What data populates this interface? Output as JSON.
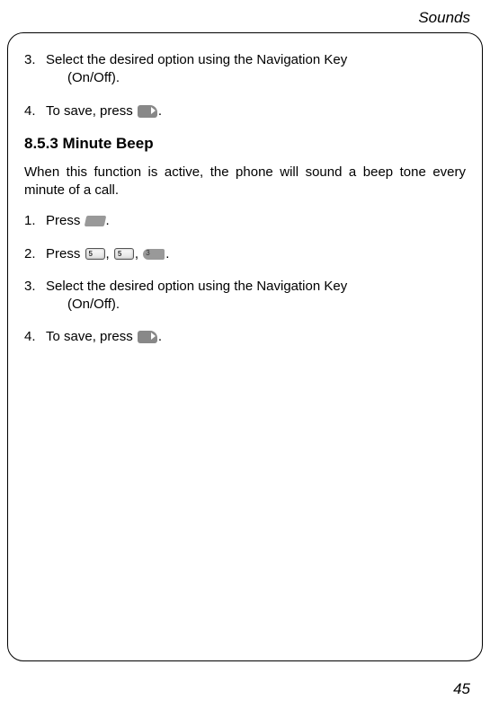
{
  "header": "Sounds",
  "page_number": "45",
  "block1": {
    "step3": {
      "num": "3.",
      "text1": "Select the desired option using the Navigation Key",
      "text2": "(On/Off)."
    },
    "step4": {
      "num": "4.",
      "text_before": "To save, press ",
      "text_after": "."
    }
  },
  "section_heading": "8.5.3 Minute Beep",
  "section_paragraph": "When this function is active, the phone will sound a beep tone every minute of a call.",
  "block2": {
    "step1": {
      "num": "1.",
      "text_before": "Press ",
      "text_after": "."
    },
    "step2": {
      "num": "2.",
      "text_before": "Press ",
      "comma": ", ",
      "text_after": "."
    },
    "step3": {
      "num": "3.",
      "text1": "Select the desired option using the Navigation Key",
      "text2": "(On/Off)."
    },
    "step4": {
      "num": "4.",
      "text_before": "To save, press ",
      "text_after": "."
    }
  },
  "icons": {
    "ok": "ok-icon",
    "soft": "softkey-icon",
    "five": "5",
    "three": "three-key-icon"
  }
}
